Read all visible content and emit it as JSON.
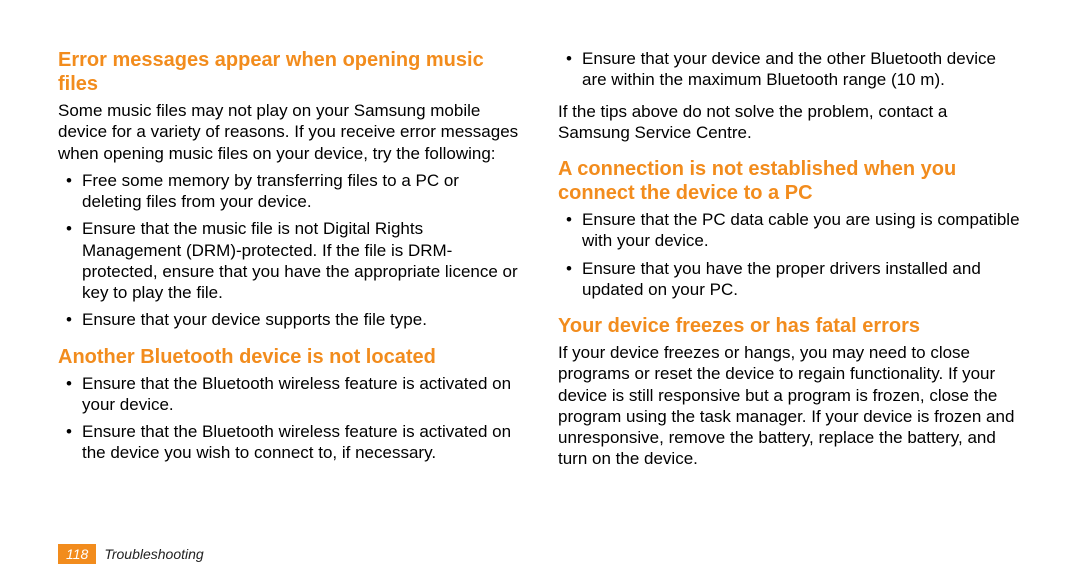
{
  "left": {
    "section1": {
      "heading": "Error messages appear when opening music files",
      "intro": "Some music files may not play on your Samsung mobile device for a variety of reasons. If you receive error messages when opening music files on your device, try the following:",
      "bullets": [
        "Free some memory by transferring files to a PC or deleting files from your device.",
        "Ensure that the music file is not Digital Rights Management (DRM)-protected. If the file is DRM-protected, ensure that you have the appropriate licence or key to play the file.",
        "Ensure that your device supports the file type."
      ]
    },
    "section2": {
      "heading": "Another Bluetooth device is not located",
      "bullets": [
        "Ensure that the Bluetooth wireless feature is activated on your device.",
        "Ensure that the Bluetooth wireless feature is activated on the device you wish to connect to, if necessary."
      ]
    }
  },
  "right": {
    "topBullets": [
      "Ensure that your device and the other Bluetooth device are within the maximum Bluetooth range (10 m)."
    ],
    "topNote": "If the tips above do not solve the problem, contact a Samsung Service Centre.",
    "section3": {
      "heading": "A connection is not established when you connect the device to a PC",
      "bullets": [
        "Ensure that the PC data cable you are using is compatible with your device.",
        "Ensure that you have the proper drivers installed and updated on your PC."
      ]
    },
    "section4": {
      "heading": "Your device freezes or has fatal errors",
      "body": "If your device freezes or hangs, you may need to close programs or reset the device to regain functionality. If your device is still responsive but a program is frozen, close the program using the task manager. If your device is frozen and unresponsive, remove the battery, replace the battery, and turn on the device."
    }
  },
  "footer": {
    "page": "118",
    "label": "Troubleshooting"
  }
}
